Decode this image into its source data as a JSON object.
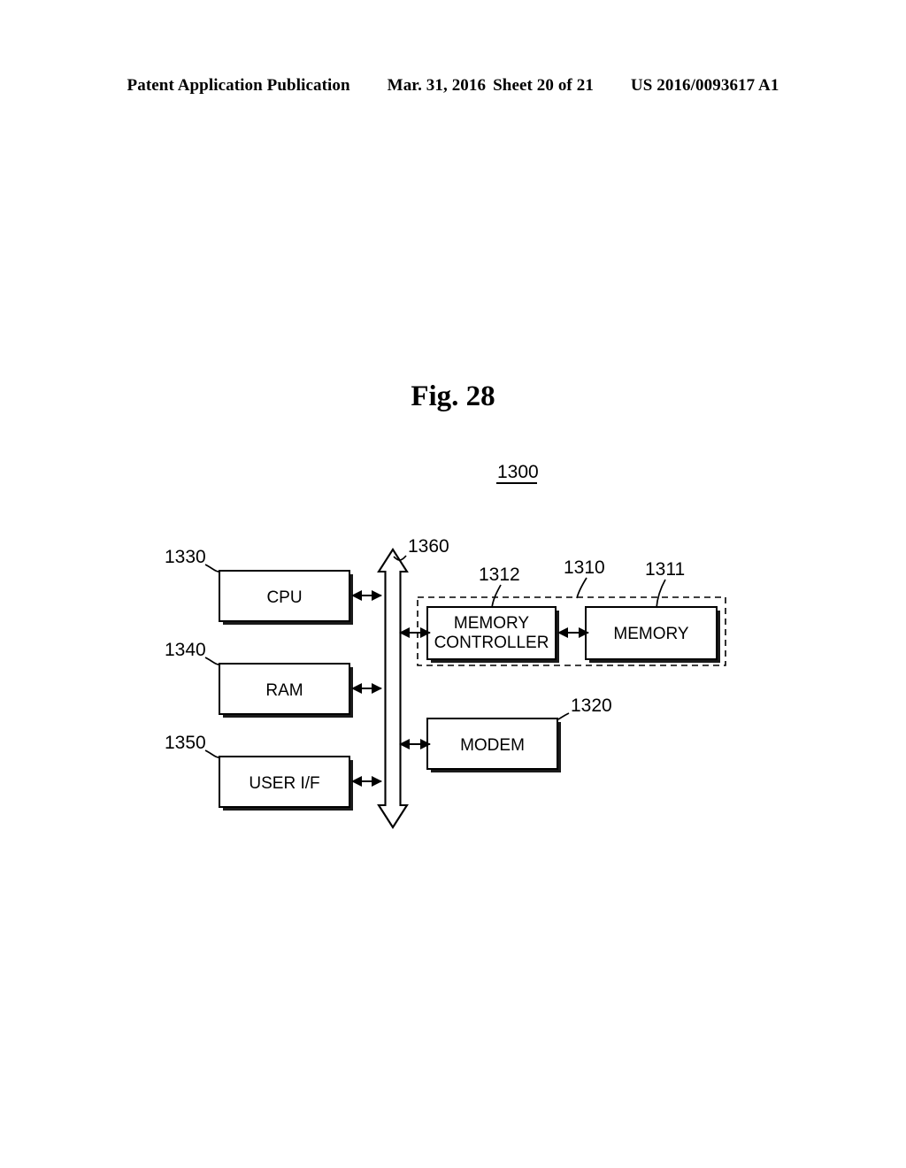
{
  "header": {
    "publication": "Patent Application Publication",
    "date": "Mar. 31, 2016",
    "sheet": "Sheet 20 of 21",
    "document_number": "US 2016/0093617 A1"
  },
  "figure": {
    "title": "Fig. 28",
    "system_ref": "1300",
    "blocks": [
      {
        "id": "cpu",
        "label": "CPU",
        "ref": "1330"
      },
      {
        "id": "ram",
        "label": "RAM",
        "ref": "1340"
      },
      {
        "id": "user-if",
        "label": "USER I/F",
        "ref": "1350"
      },
      {
        "id": "memory-controller",
        "label_line1": "MEMORY",
        "label_line2": "CONTROLLER",
        "ref": "1312"
      },
      {
        "id": "memory",
        "label": "MEMORY",
        "ref": "1311"
      },
      {
        "id": "modem",
        "label": "MODEM",
        "ref": "1320"
      }
    ],
    "groups": [
      {
        "id": "memory-system",
        "ref": "1310"
      }
    ],
    "bus": {
      "id": "system-bus",
      "ref": "1360"
    },
    "colors": {
      "ink": "#000000",
      "paper": "#ffffff",
      "shadow": "#1a1a1a"
    }
  }
}
